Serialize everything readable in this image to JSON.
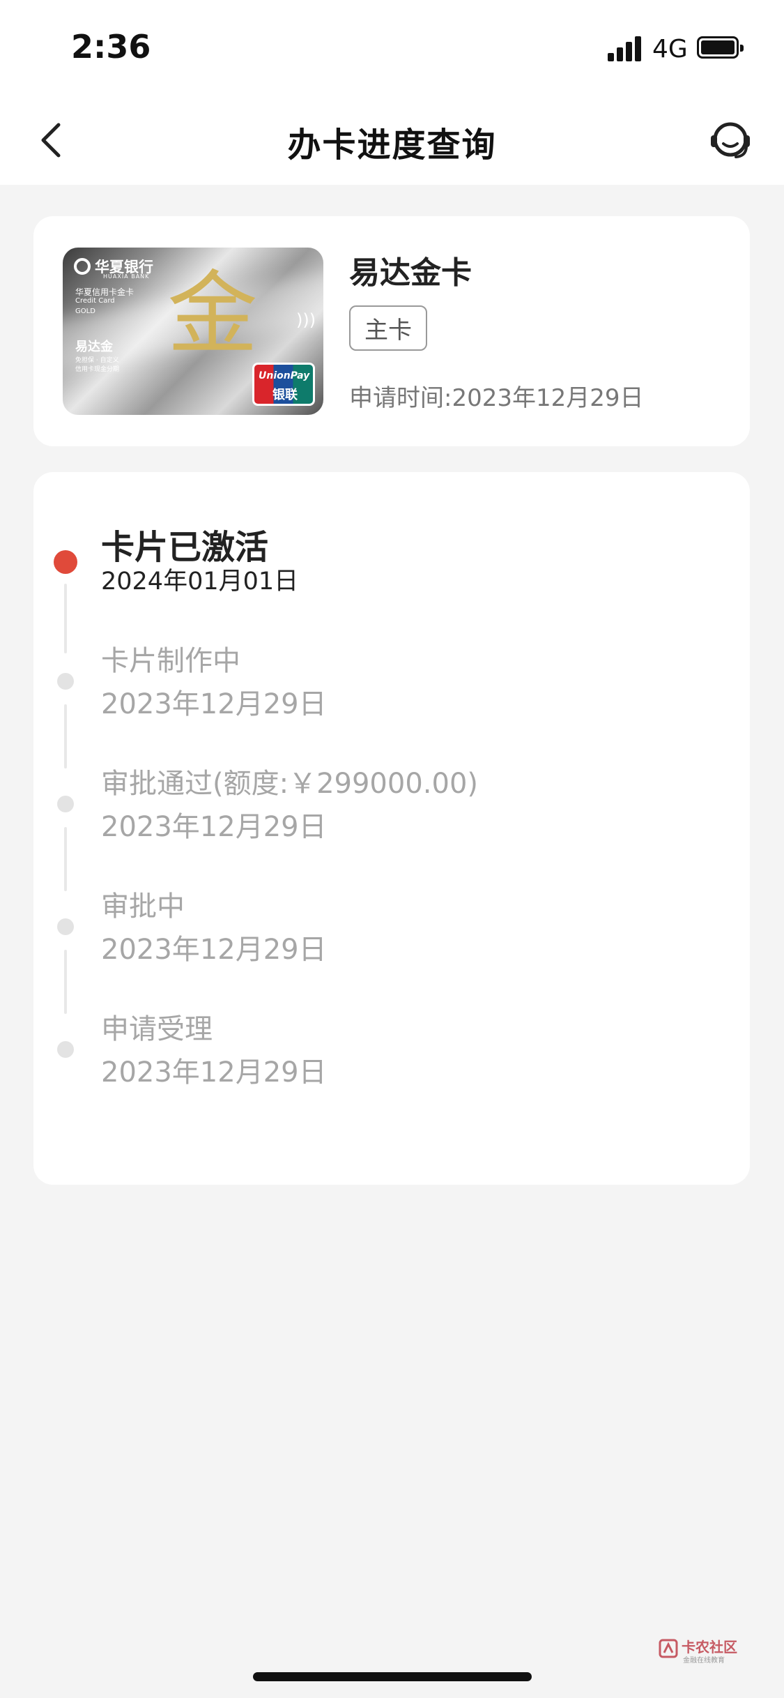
{
  "status_bar": {
    "time": "2:36",
    "network": "4G",
    "icons": [
      "signal-icon",
      "battery-icon"
    ]
  },
  "nav": {
    "title": "办卡进度查询",
    "back_icon": "chevron-left-icon",
    "service_icon": "customer-service-icon"
  },
  "card": {
    "name": "易达金卡",
    "tag": "主卡",
    "apply_label": "申请时间:",
    "apply_date": "2023年12月29日",
    "image": {
      "bank_name": "华夏银行",
      "bank_name_en": "HUAXIA BANK",
      "line1": "华夏信用卡金卡",
      "line2": "Credit Card",
      "line3": "GOLD",
      "product": "易达金",
      "small1": "免担保 · 自定义",
      "small2": "信用卡现金分期",
      "gold_char": "金",
      "brand_en": "UnionPay",
      "brand_cn": "银联"
    }
  },
  "timeline": [
    {
      "title": "卡片已激活",
      "date": "2024年01月01日",
      "status": "current"
    },
    {
      "title": "卡片制作中",
      "date": "2023年12月29日",
      "status": "done"
    },
    {
      "title": "审批通过(额度:￥299000.00)",
      "date": "2023年12月29日",
      "status": "done"
    },
    {
      "title": "审批中",
      "date": "2023年12月29日",
      "status": "done"
    },
    {
      "title": "申请受理",
      "date": "2023年12月29日",
      "status": "done"
    }
  ],
  "watermark": {
    "text": "卡农社区",
    "sub": "金融在线教育"
  },
  "colors": {
    "accent": "#e04a3a",
    "background": "#f4f4f4",
    "panel": "#ffffff",
    "muted_text": "#a6a6a6"
  }
}
